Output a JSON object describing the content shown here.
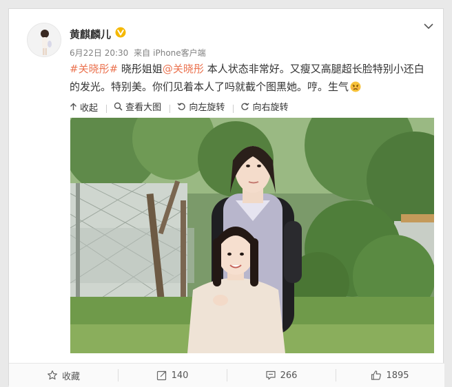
{
  "post": {
    "username": "黄麒麟儿",
    "date": "6月22日 20:30",
    "source_prefix": "来自",
    "source": "iPhone客户端",
    "text_parts": [
      {
        "text": "#关晓彤#",
        "link": true
      },
      {
        "text": " 晓彤姐姐",
        "link": false
      },
      {
        "text": "@关晓彤",
        "link": true
      },
      {
        "text": " 本人状态非常好。又瘦又高腿超长脸特别小还白的发光。特别美。你们见着本人了吗就截个图黑她。哼。生气",
        "link": false
      }
    ]
  },
  "toolbar": {
    "collapse": "收起",
    "view_large": "查看大图",
    "rotate_left": "向左旋转",
    "rotate_right": "向右旋转"
  },
  "footer": {
    "favorite": "收藏",
    "repost_count": "140",
    "comment_count": "266",
    "like_count": "1895"
  },
  "colors": {
    "link": "#eb7350",
    "vip_badge": "#f5b800",
    "meta": "#808080"
  },
  "icons": [
    "avatar",
    "vip-badge-icon",
    "chevron-down-icon",
    "angry-emoji-icon",
    "collapse-icon",
    "magnifier-icon",
    "rotate-left-icon",
    "rotate-right-icon",
    "star-icon",
    "repost-icon",
    "comment-icon",
    "thumbs-up-icon"
  ]
}
